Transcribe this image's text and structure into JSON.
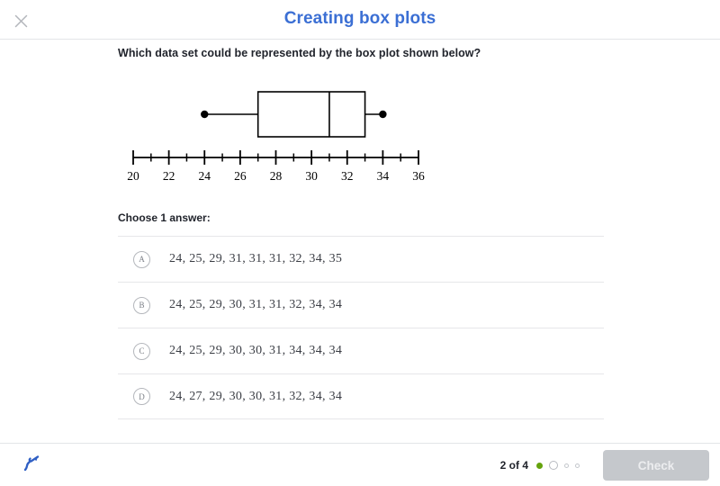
{
  "header": {
    "title": "Creating box plots",
    "close_icon": "close-icon"
  },
  "question": {
    "prompt": "Which data set could be represented by the box plot shown below?",
    "choose_label": "Choose 1 answer:"
  },
  "chart_data": {
    "type": "box",
    "title": "",
    "xlabel": "",
    "ylabel": "",
    "xlim": [
      20,
      36
    ],
    "grid": false,
    "major_tick_step": 2,
    "minor_tick_step": 1,
    "tick_labels": [
      "20",
      "22",
      "24",
      "26",
      "28",
      "30",
      "32",
      "34",
      "36"
    ],
    "tick_values": [
      20,
      22,
      24,
      26,
      28,
      30,
      32,
      34,
      36
    ],
    "series": [
      {
        "name": "box plot",
        "min": 24,
        "q1": 27,
        "median": 31,
        "q3": 33,
        "max": 34,
        "whisker_cap_style": "dot"
      }
    ],
    "stroke_color": "#000000"
  },
  "answers": {
    "options": [
      {
        "letter": "A",
        "text": "24, 25, 29, 31, 31, 31, 32, 34, 35"
      },
      {
        "letter": "B",
        "text": "24, 25, 29, 30, 31, 31, 32, 34, 34"
      },
      {
        "letter": "C",
        "text": "24, 25, 29, 30, 30, 31, 34, 34, 34"
      },
      {
        "letter": "D",
        "text": "24, 27, 29, 30, 30, 31, 32, 34, 34"
      }
    ]
  },
  "footer": {
    "scratchpad_icon": "scratchpad-pen-icon",
    "progress_text": "2 of 4",
    "dots": [
      {
        "state": "done"
      },
      {
        "state": "current"
      },
      {
        "state": "todo"
      },
      {
        "state": "todo"
      }
    ],
    "check_label": "Check"
  },
  "colors": {
    "title_blue": "#3b6fd4",
    "progress_green": "#65a30d",
    "check_disabled_bg": "#c5c8cc",
    "scratchpad_blue": "#2f5fc4"
  }
}
